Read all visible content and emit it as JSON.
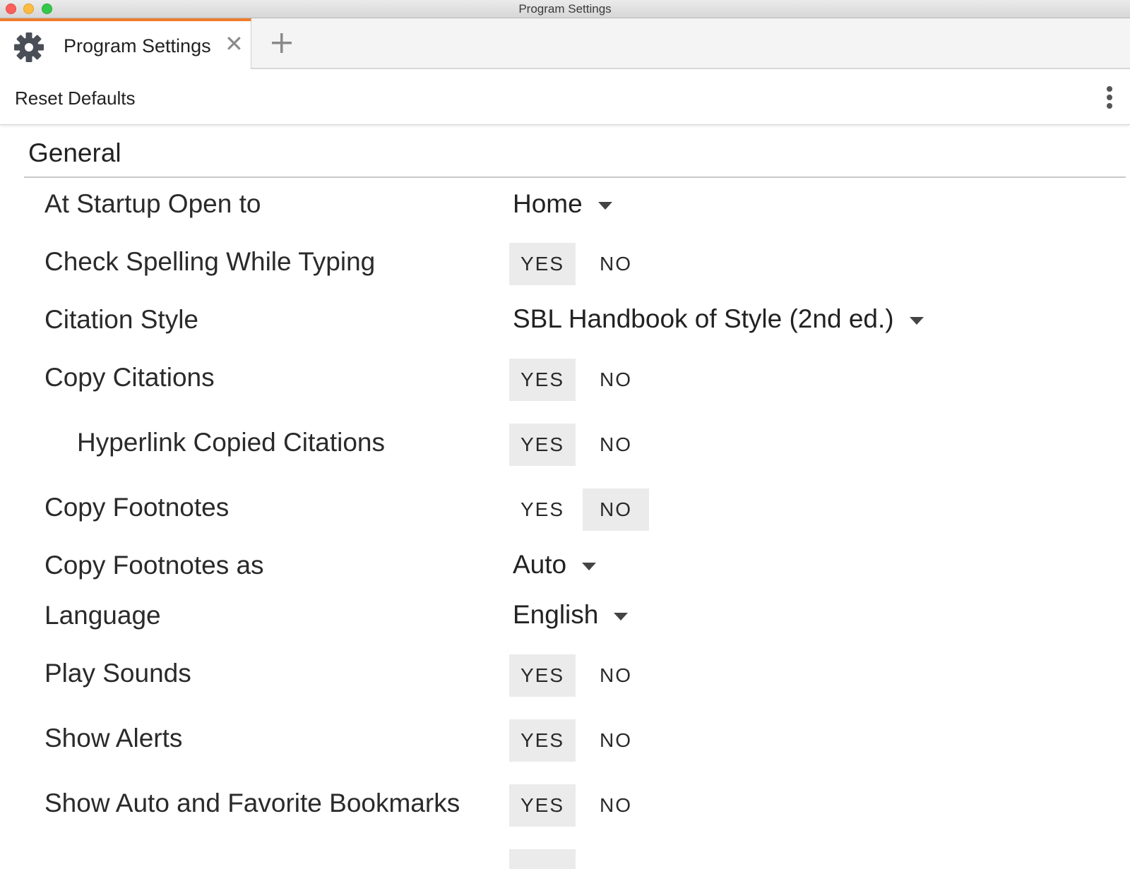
{
  "window": {
    "title": "Program Settings"
  },
  "tabs": [
    {
      "label": "Program Settings",
      "icon": "gear-icon",
      "close_glyph": "✕"
    }
  ],
  "new_tab_icon": "plus-icon",
  "toolbar": {
    "reset_label": "Reset Defaults",
    "more_icon": "more-vertical-icon"
  },
  "section": {
    "title": "General"
  },
  "settings": [
    {
      "label": "At Startup Open to",
      "type": "dropdown",
      "value": "Home"
    },
    {
      "label": "Check Spelling While Typing",
      "type": "toggle",
      "yes": "YES",
      "no": "NO",
      "selected": "yes"
    },
    {
      "label": "Citation Style",
      "type": "dropdown",
      "value": "SBL Handbook of Style (2nd ed.)"
    },
    {
      "label": "Copy Citations",
      "type": "toggle",
      "yes": "YES",
      "no": "NO",
      "selected": "yes"
    },
    {
      "label": "Hyperlink Copied Citations",
      "type": "toggle",
      "yes": "YES",
      "no": "NO",
      "selected": "yes",
      "indent": true
    },
    {
      "label": "Copy Footnotes",
      "type": "toggle",
      "yes": "YES",
      "no": "NO",
      "selected": "no"
    },
    {
      "label": "Copy Footnotes as",
      "type": "dropdown",
      "value": "Auto"
    },
    {
      "label": "Language",
      "type": "dropdown",
      "value": "English"
    },
    {
      "label": "Play Sounds",
      "type": "toggle",
      "yes": "YES",
      "no": "NO",
      "selected": "yes"
    },
    {
      "label": "Show Alerts",
      "type": "toggle",
      "yes": "YES",
      "no": "NO",
      "selected": "yes"
    },
    {
      "label": "Show Auto and Favorite Bookmarks",
      "type": "toggle",
      "yes": "YES",
      "no": "NO",
      "selected": "yes"
    }
  ],
  "colors": {
    "accent": "#f07d2c",
    "selected_bg": "#ebebeb"
  }
}
